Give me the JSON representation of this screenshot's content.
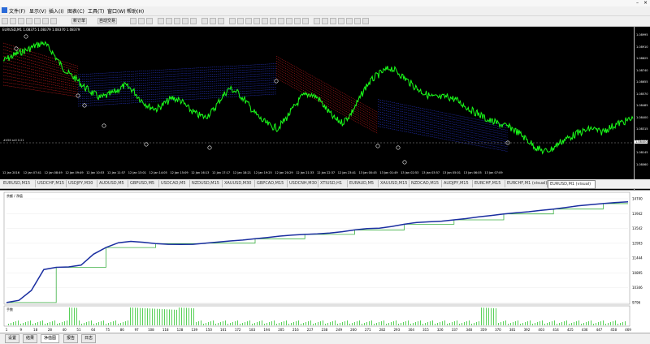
{
  "menu": [
    "文件(F)",
    "显示(V)",
    "插入(I)",
    "图表(C)",
    "工具(T)",
    "窗口(W)",
    "帮助(H)"
  ],
  "toolbar": {
    "new_order": "新订单",
    "auto_trading": "自动交易"
  },
  "chart": {
    "title": "EURUSD,M1  1.08375 1.08379 1.08370 1.08379",
    "hline_label": "#456 sell 0.21",
    "price_ticks": [
      "1.08995",
      "1.08910",
      "1.08825",
      "1.08740",
      "1.08655",
      "1.08570",
      "1.08485",
      "1.08400",
      "1.08315",
      "1.08230",
      "1.08145",
      "1.08060"
    ],
    "time_ticks": [
      "12 Jan 2016",
      "12 Jan 07:41",
      "12 Jan 08:49",
      "12 Jan 09:49",
      "12 Jan 10:53",
      "12 Jan 11:57",
      "12 Jan 13:01",
      "12 Jan 14:05",
      "12 Jan 15:09",
      "12 Jan 16:13",
      "12 Jan 17:17",
      "12 Jan 18:21",
      "12 Jan 19:25",
      "12 Jan 20:29",
      "12 Jan 21:33",
      "12 Jan 22:37",
      "12 Jan 23:41",
      "13 Jan 00:45",
      "13 Jan 01:49",
      "13 Jan 02:53",
      "13 Jan 03:57",
      "13 Jan 05:01",
      "13 Jan 06:05",
      "13 Jan 07:09"
    ]
  },
  "symbol_tabs": [
    "EURUSD,M15",
    "USDCHF,M15",
    "USDJPY,M30",
    "AUDUSD,M5",
    "GBPUSD,M5",
    "USDCAD,M5",
    "NZDUSD,M15",
    "XAUUSD,M30",
    "GBPCAD,M15",
    "USDCNH,M30",
    "XTIUSD,H1",
    "EURAUD,M5",
    "XAUUSD,M15",
    "NZDCAD,M15",
    "AUDJPY,M15",
    "EURCHF,M15",
    "EURCHF,M1 (visual)",
    "EURUSD,M1 (visual)"
  ],
  "tester": {
    "equity_label": "余额 / 净值",
    "volume_label": "手数",
    "y_ticks": [
      "14740",
      "13942",
      "13542",
      "12993",
      "11444",
      "10895",
      "10346",
      "9796"
    ],
    "x_ticks": [
      "1",
      "9",
      "18",
      "28",
      "40",
      "51",
      "64",
      "75",
      "86",
      "97",
      "108",
      "118",
      "128",
      "139",
      "150",
      "161",
      "172",
      "183",
      "194",
      "205",
      "216",
      "227",
      "238",
      "249",
      "260",
      "271",
      "282",
      "293",
      "304",
      "315",
      "326",
      "337",
      "348",
      "359",
      "370",
      "381",
      "392",
      "403",
      "414",
      "425",
      "436",
      "447",
      "458",
      "469"
    ],
    "colors": {
      "equity": "#1a2ea0",
      "balance": "#3cb043",
      "volume": "#58d058"
    }
  },
  "bottom_tabs": [
    "设置",
    "结果",
    "净值图",
    "报告",
    "日志"
  ],
  "chart_data": [
    {
      "type": "line",
      "title": "EURUSD,M1",
      "series": [],
      "ylim": [
        1.0806,
        1.0905
      ],
      "y": [
        1.0885,
        1.0888,
        1.0891,
        1.0893,
        1.0896,
        1.0898,
        1.0892,
        1.0883,
        1.0876,
        1.0872,
        1.0866,
        1.0862,
        1.0858,
        1.086,
        1.0863,
        1.0867,
        1.0864,
        1.0857,
        1.0852,
        1.085,
        1.0854,
        1.0858,
        1.0856,
        1.085,
        1.0846,
        1.0844,
        1.0849,
        1.0858,
        1.0865,
        1.0862,
        1.0856,
        1.0848,
        1.0842,
        1.0838,
        1.0836,
        1.0843,
        1.0851,
        1.0859,
        1.0861,
        1.0858,
        1.085,
        1.0843,
        1.084,
        1.0846,
        1.0856,
        1.0867,
        1.0873,
        1.0877,
        1.088,
        1.0876,
        1.0871,
        1.0866,
        1.0862,
        1.0859,
        1.0858,
        1.0859,
        1.0857,
        1.0853,
        1.0849,
        1.0846,
        1.0842,
        1.084,
        1.0838,
        1.0836,
        1.0832,
        1.0827,
        1.0822,
        1.0819,
        1.0821,
        1.0826,
        1.0829,
        1.0832,
        1.0834,
        1.0836,
        1.0833,
        1.0836,
        1.0839,
        1.0841,
        1.0843
      ]
    },
    {
      "type": "line",
      "title": "",
      "series": [
        {
          "name": "",
          "values": [
            9800,
            9900,
            10350,
            11300,
            11400,
            11420,
            11500,
            12000,
            12300,
            12520,
            12580,
            12540,
            12480,
            12450,
            12440,
            12450,
            12500,
            12550,
            12600,
            12640,
            12700,
            12760,
            12820,
            12870,
            12900,
            12920,
            12960,
            13020,
            13100,
            13160,
            13180,
            13260,
            13360,
            13440,
            13470,
            13500,
            13560,
            13620,
            13700,
            13760,
            13830,
            13880,
            13930,
            13990,
            14050,
            14120,
            14200,
            14250,
            14300,
            14350,
            14380
          ]
        }
      ],
      "ylim": [
        9796,
        14740
      ]
    }
  ]
}
